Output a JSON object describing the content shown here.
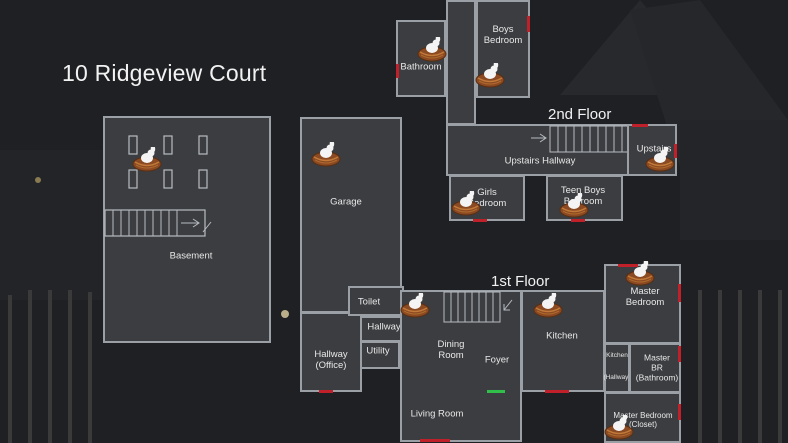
{
  "title": "10 Ridgeview Court",
  "floors": {
    "second": "2nd Floor",
    "first": "1st Floor"
  },
  "rooms": {
    "basement": "Basement",
    "garage": "Garage",
    "bathroom": "Bathroom",
    "boys_bedroom": "Boys\nBedroom",
    "upstairs_hallway": "Upstairs Hallway",
    "upstairs": "Upstairs",
    "girls_bedroom": "Girls\nBedroom",
    "teen_boys_bedroom": "Teen Boys\nBedroom",
    "toilet": "Toilet",
    "hallway": "Hallway",
    "hallway_office": "Hallway\n(Office)",
    "utility": "Utility",
    "dining_room": "Dining\nRoom",
    "foyer": "Foyer",
    "kitchen": "Kitchen",
    "kitchen_hallway": "Kitchen\n\n\n(Hallway)",
    "master_bedroom": "Master\nBedroom",
    "master_br_bathroom": "Master\nBR\n(Bathroom)",
    "master_bedroom_closet": "Master Bedroom\n(Closet)",
    "living_room": "Living Room"
  },
  "markers": {
    "icon": "easter-bunny-nest-icon",
    "count": 10
  },
  "colors": {
    "room_fill": "#3b3d40",
    "wall": "#9aa0a6",
    "door": "#c0202a",
    "exit": "#2fbf4a"
  }
}
